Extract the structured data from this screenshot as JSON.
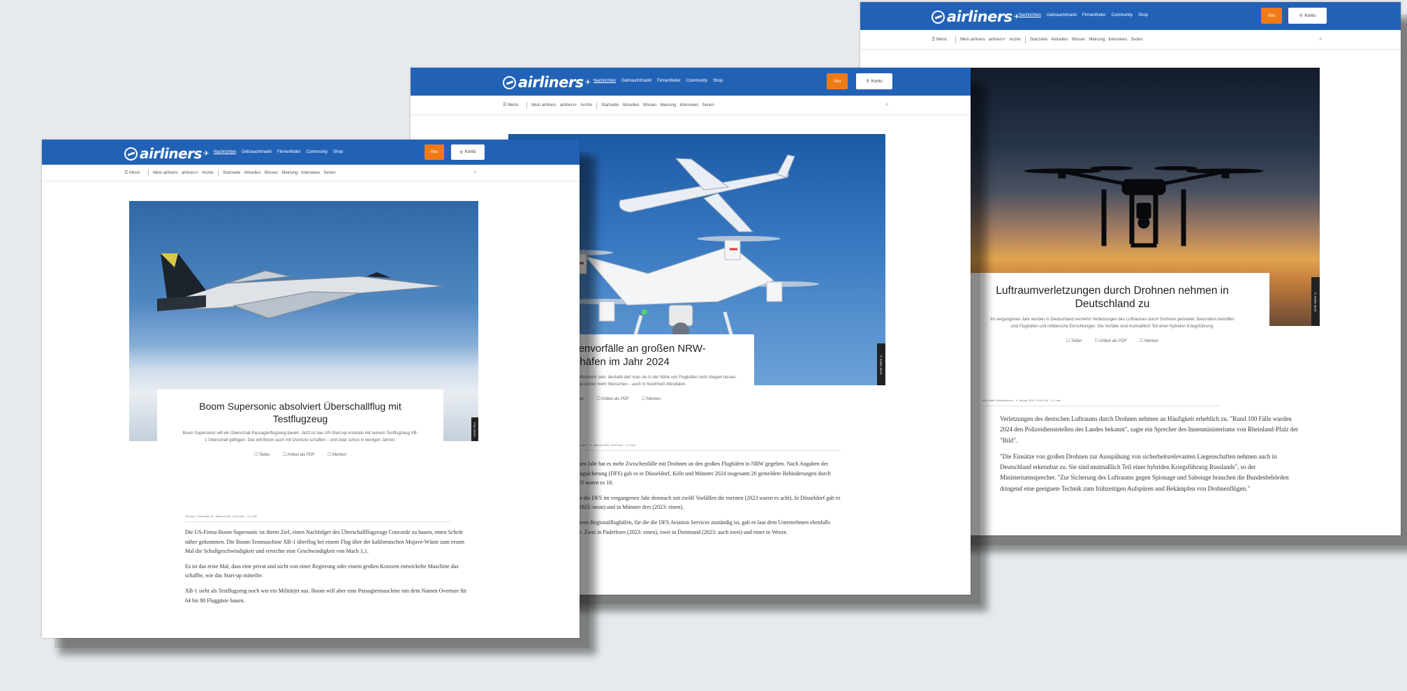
{
  "site": {
    "logo": "airliners",
    "nav": [
      "Nachrichten",
      "Gebrauchtmarkt",
      "Firmenfinder",
      "Community",
      "Shop"
    ],
    "abo_label": "Abo",
    "konto_label": "Konto",
    "menu_label": "☰ Menü",
    "subnav_primary": [
      "Mein airliners",
      "airliners+",
      "Archiv"
    ],
    "subnav_secondary": [
      "Startseite",
      "Aktuelles",
      "Wissen",
      "Meinung",
      "Interviews",
      "Serien"
    ],
    "search_icon": "⌕"
  },
  "articles": [
    {
      "title": "Boom Supersonic absolviert Überschallflug mit Testflugzeug",
      "lede": "Boom Supersonic will ein Überschall-Passagierflugzeug bauen. Jetzt ist das US-Start-up erstmals mit seinem Testflugzeug XB-1 Überschall geflogen. Das will Boom auch mit Overture schaffen – und zwar schon in wenigen Jahren.",
      "actions": [
        "Teilen",
        "Artikel als PDF",
        "Merken"
      ],
      "meta": "Von dpa · Dienstag, 29. Januar 2025, 10:24 Uhr · ◷ 1 min",
      "credit": "Foto: Boom",
      "paragraphs": [
        "Die US-Firma Boom Supersonic ist ihrem Ziel, einen Nachfolger des Überschallflugzeugs Concorde zu bauen, einen Schritt näher gekommen. Die Boom-Testmaschine XB-1 überflog bei einem Flug über der kalifornischen Mojave-Wüste zum ersten Mal die Schallgeschwindigkeit und erreichte eine Geschwindigkeit von Mach 1,1.",
        "Es ist das erste Mal, dass eine privat und nicht von einer Regierung oder einem großen Konzern entwickelte Maschine das schaffte, wie das Start-up mitteilte.",
        "XB-1 sieht als Testflugzeug noch wie ein Militärjet aus. Boom will aber eine Passagiermaschine mit dem Namen Overture für 64 bis 80 Fluggäste bauen."
      ]
    },
    {
      "title": "Mehr Drohnenvorfälle an großen NRW-Flughäfen im Jahr 2024",
      "lede": "Private Drohnen können eine Gefahr für den Luftverkehr sein, deshalb darf man sie in der Nähe von Flughäfen nicht steigen lassen. Dennoch machen das immer mehr Menschen – auch in Nordrhein-Westfalen.",
      "actions": [
        "Teilen",
        "Artikel als PDF",
        "Merken"
      ],
      "meta": "Von dpa · 21. Januar 2025, 10:03 Uhr · ◷ 2 min",
      "credit": "© Adobe Stock",
      "paragraphs": [
        "Im vergangenen Jahr hat es mehr Zwischenfälle mit Drohnen an den großen Flughäfen in NRW gegeben. Nach Angaben der Deutschen Flugsicherung (DFS) gab es in Düsseldorf, Köln und Münster 2024 insgesamt 26 gemeldete Behinderungen durch Drohnen. 2023 waren es 18.",
        "In Köln zählte die DFS im vergangenen Jahr demnach mit zwölf Vorfällen die meisten (2023 waren es acht). In Düsseldorf gab es elf Vorfälle (2023: neun) und in Münster drei (2023: einen).",
        "An den kleineren Regionalflughäfen, für die die DFS Aviation Services zuständig ist, gab es laut dem Unternehmen ebenfalls einzelne Fälle. Zwei in Paderborn (2023: einen), zwei in Dortmund (2023: auch zwei) und einer in Weeze."
      ]
    },
    {
      "title": "Luftraumverletzungen durch Drohnen nehmen in Deutschland zu",
      "lede": "Im vergangenen Jahr wurden in Deutschland vermehrt Verletzungen des Luftraumes durch Drohnen gemeldet. Besonders betroffen sind Flughäfen und militärische Einrichtungen. Die Vorfälle sind mutmaßlich Teil einer hybriden Kriegsführung.",
      "actions": [
        "Teilen",
        "Artikel als PDF",
        "Merken"
      ],
      "meta": "Von Katrin Wesenheimer · 9. Januar 2025, 10:00 Uhr · ◷ 1 min",
      "credit": "© Adobe Stock",
      "paragraphs": [
        "Verletzungen des deutschen Luftraums durch Drohnen nehmen an Häufigkeit erheblich zu. \"Rund 100 Fälle wurden 2024 den Polizeidienststellen des Landes bekannt\", sagte ein Sprecher des Innenministeriums von Rheinland-Pfalz der \"Bild\".",
        "\"Die Einsätze von großen Drohnen zur Ausspähung von sicherheitsrelevanten Liegenschaften nehmen auch in Deutschland erkennbar zu. Sie sind mutmaßlich Teil einer hybriden Kriegsführung Russlands\", so der Ministeriumssprecher. \"Zur Sicherung des Luftraums gegen Spionage und Sabotage brauchen die Bundesbehörden dringend eine geeignete Technik zum frühzeitigen Aufspüren und Bekämpfen von Drohnenflügen.\""
      ]
    }
  ]
}
